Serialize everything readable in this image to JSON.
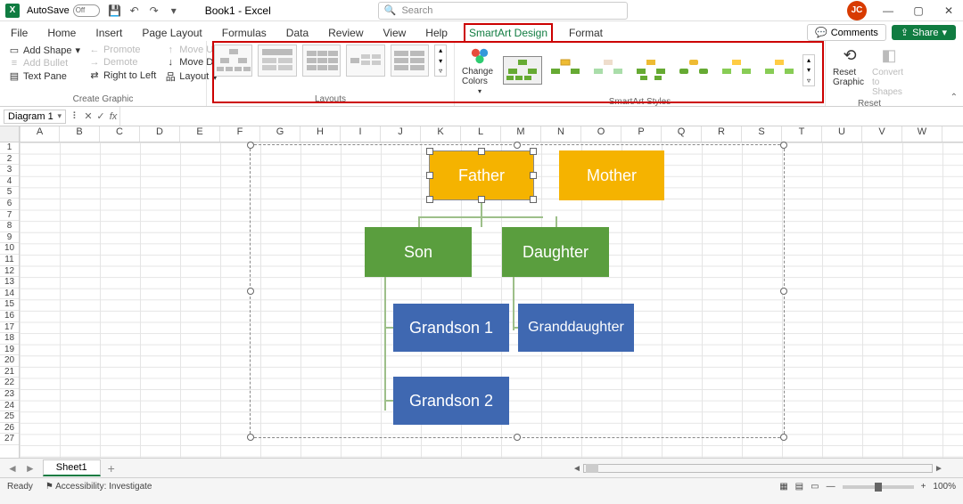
{
  "titlebar": {
    "autosave_label": "AutoSave",
    "autosave_state": "Off",
    "doc_title": "Book1 - Excel",
    "search_placeholder": "Search",
    "user_initials": "JC"
  },
  "tabs": {
    "file": "File",
    "home": "Home",
    "insert": "Insert",
    "page_layout": "Page Layout",
    "formulas": "Formulas",
    "data": "Data",
    "review": "Review",
    "view": "View",
    "help": "Help",
    "smartart_design": "SmartArt Design",
    "format": "Format",
    "comments": "Comments",
    "share": "Share"
  },
  "ribbon": {
    "create_graphic": {
      "add_shape": "Add Shape",
      "add_bullet": "Add Bullet",
      "text_pane": "Text Pane",
      "promote": "Promote",
      "demote": "Demote",
      "right_to_left": "Right to Left",
      "move_up": "Move Up",
      "move_down": "Move Down",
      "layout": "Layout",
      "group_label": "Create Graphic"
    },
    "layouts": {
      "group_label": "Layouts"
    },
    "change_colors": "Change Colors",
    "smartart_styles": {
      "group_label": "SmartArt Styles"
    },
    "reset": {
      "reset_graphic": "Reset Graphic",
      "convert_to_shapes": "Convert to Shapes",
      "group_label": "Reset"
    }
  },
  "formula_bar": {
    "name_box": "Diagram 1"
  },
  "columns": [
    "A",
    "B",
    "C",
    "D",
    "E",
    "F",
    "G",
    "H",
    "I",
    "J",
    "K",
    "L",
    "M",
    "N",
    "O",
    "P",
    "Q",
    "R",
    "S",
    "T",
    "U",
    "V",
    "W"
  ],
  "rows": [
    "1",
    "2",
    "3",
    "4",
    "5",
    "6",
    "7",
    "8",
    "9",
    "10",
    "11",
    "12",
    "13",
    "14",
    "15",
    "16",
    "17",
    "18",
    "19",
    "20",
    "21",
    "22",
    "23",
    "24",
    "25",
    "26",
    "27"
  ],
  "smartart": {
    "father": "Father",
    "mother": "Mother",
    "son": "Son",
    "daughter": "Daughter",
    "grandson1": "Grandson 1",
    "granddaughter": "Granddaughter",
    "grandson2": "Grandson 2"
  },
  "sheet_tabs": {
    "sheet1": "Sheet1"
  },
  "statusbar": {
    "ready": "Ready",
    "accessibility": "Accessibility: Investigate",
    "zoom": "100%"
  },
  "colors": {
    "orange": "#f5b300",
    "green": "#5a9e3e",
    "blue": "#3f68b1",
    "accent": "#107c41",
    "highlight": "#c00000"
  }
}
